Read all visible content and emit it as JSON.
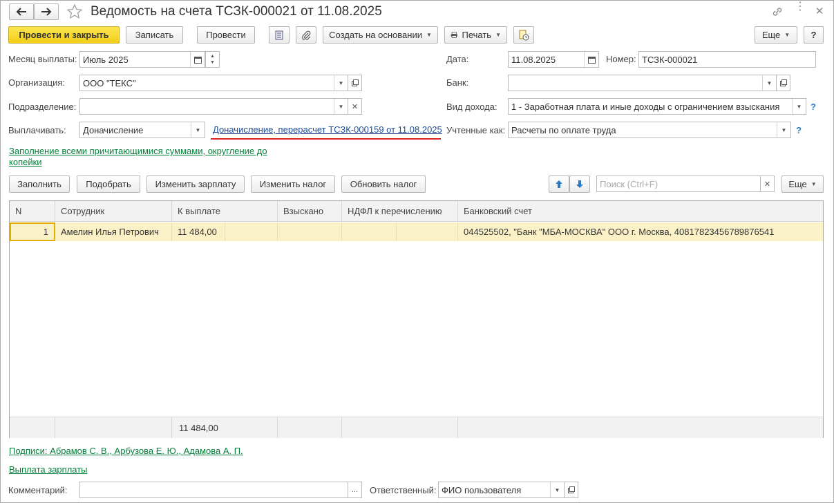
{
  "window": {
    "title": "Ведомость на счета ТСЗК-000021 от 11.08.2025"
  },
  "toolbar": {
    "post_close": "Провести и закрыть",
    "save": "Записать",
    "post": "Провести",
    "create_based": "Создать на основании",
    "print": "Печать",
    "more": "Еще",
    "help": "?"
  },
  "form": {
    "month_label": "Месяц выплаты:",
    "month_value": "Июль 2025",
    "date_label": "Дата:",
    "date_value": "11.08.2025",
    "number_label": "Номер:",
    "number_value": "ТСЗК-000021",
    "org_label": "Организация:",
    "org_value": "ООО \"ТЕКС\"",
    "bank_label": "Банк:",
    "bank_value": "",
    "division_label": "Подразделение:",
    "division_value": "",
    "income_label": "Вид дохода:",
    "income_value": "1 - Заработная плата и иные доходы с ограничением взыскания",
    "pay_label": "Выплачивать:",
    "pay_value": "Доначисление",
    "pay_link": "Доначисление, перерасчет ТСЗК-000159 от 11.08.2025",
    "accounted_label": "Учтенные как:",
    "accounted_value": "Расчеты по оплате труда",
    "fill_link": "Заполнение всеми причитающимися суммами, округление до копейки"
  },
  "table_toolbar": {
    "fill": "Заполнить",
    "pick": "Подобрать",
    "change_salary": "Изменить зарплату",
    "change_tax": "Изменить налог",
    "update_tax": "Обновить налог",
    "search_placeholder": "Поиск (Ctrl+F)",
    "more": "Еще"
  },
  "table": {
    "headers": {
      "n": "N",
      "employee": "Сотрудник",
      "to_pay": "К выплате",
      "withheld": "Взыскано",
      "ndfl": "НДФЛ к перечислению",
      "account": "Банковский счет"
    },
    "rows": [
      {
        "n": "1",
        "employee": "Амелин Илья Петрович",
        "to_pay": "11 484,00",
        "withheld": "",
        "ndfl": "",
        "account": "044525502, \"Банк \"МБА-МОСКВА\" ООО г. Москва, 40817823456789876541"
      }
    ],
    "total_to_pay": "11 484,00"
  },
  "footer": {
    "signatures_link": "Подписи: Абрамов С. В., Арбузова Е. Ю., Адамова А. П.",
    "payout_link": "Выплата зарплаты",
    "comment_label": "Комментарий:",
    "comment_value": "",
    "comment_btn": "...",
    "responsible_label": "Ответственный:",
    "responsible_value": "ФИО пользователя"
  },
  "colors": {
    "primary_button": "#f4cf1a",
    "link_green": "#05803a",
    "link_blue": "#1d4b93",
    "row_selected": "#fbf1c7",
    "annotation_underline": "#e02020"
  }
}
